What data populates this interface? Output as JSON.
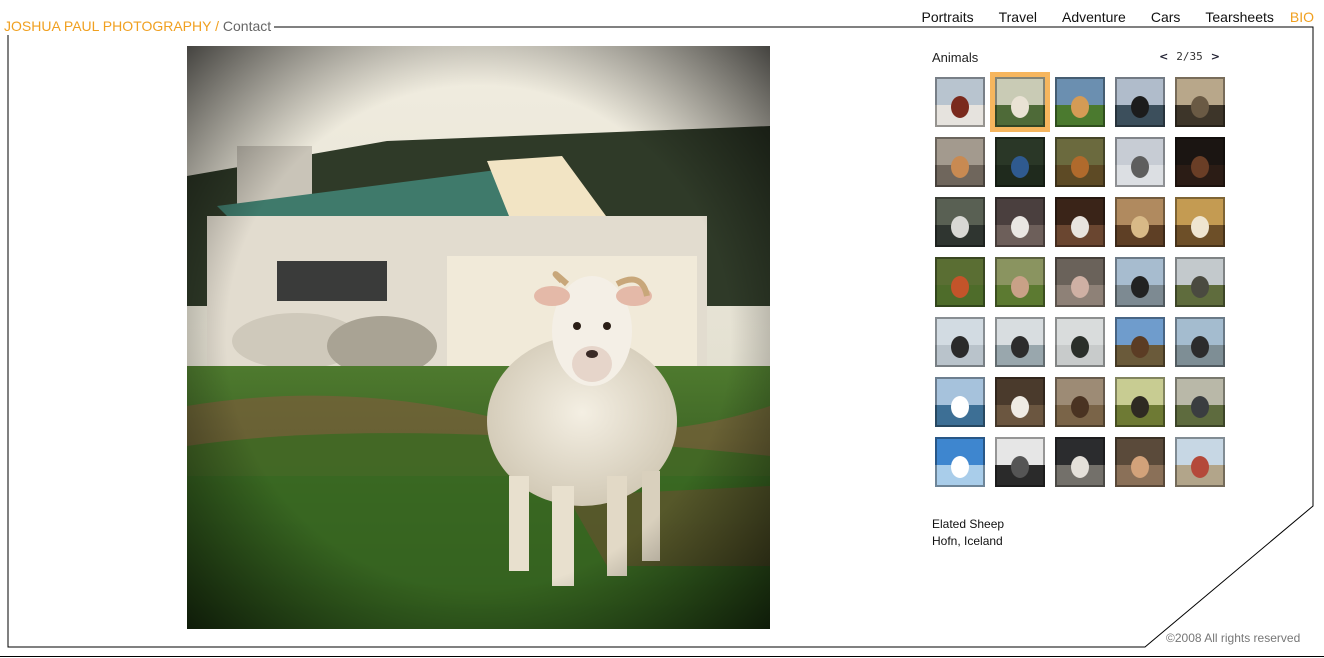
{
  "header": {
    "brand_name": "JOSHUA PAUL PHOTOGRAPHY",
    "brand_separator": " / ",
    "contact_label": "Contact"
  },
  "nav": {
    "items": [
      {
        "label": "Portraits"
      },
      {
        "label": "Travel"
      },
      {
        "label": "Adventure"
      },
      {
        "label": "Cars"
      },
      {
        "label": "Tearsheets"
      }
    ],
    "bio_label": "BIO"
  },
  "gallery": {
    "category": "Animals",
    "prev_icon": "<",
    "next_icon": ">",
    "page_indicator": "2/35",
    "selected_index": 1,
    "thumbnails": [
      {
        "icon": "thumb-child-snow",
        "sky": "#b8c4cf",
        "ground": "#e6e3de",
        "subject": "#7a2a1d"
      },
      {
        "icon": "thumb-sheep",
        "sky": "#c9cbb5",
        "ground": "#4e6a38",
        "subject": "#e9e2d4"
      },
      {
        "icon": "thumb-dog-field",
        "sky": "#6b8fb0",
        "ground": "#4b7a2f",
        "subject": "#d49b55"
      },
      {
        "icon": "thumb-black-dog",
        "sky": "#b0bccb",
        "ground": "#3c4f5c",
        "subject": "#1c1c1c"
      },
      {
        "icon": "thumb-shed",
        "sky": "#b8a78a",
        "ground": "#3d3529",
        "subject": "#6a5a44"
      },
      {
        "icon": "thumb-cat-floor",
        "sky": "#a39a8e",
        "ground": "#6f665c",
        "subject": "#c88a52"
      },
      {
        "icon": "thumb-peacock",
        "sky": "#2a3727",
        "ground": "#1f2a1d",
        "subject": "#2f5a8f"
      },
      {
        "icon": "thumb-fox",
        "sky": "#6b6a3e",
        "ground": "#5d4a25",
        "subject": "#b06a2c"
      },
      {
        "icon": "thumb-husky",
        "sky": "#c7ccd4",
        "ground": "#dcdfe3",
        "subject": "#5e5e5e"
      },
      {
        "icon": "thumb-brown-dog",
        "sky": "#1b1512",
        "ground": "#2b1c15",
        "subject": "#6a3e26"
      },
      {
        "icon": "thumb-monkeys",
        "sky": "#596053",
        "ground": "#2f3530",
        "subject": "#d8d8d4"
      },
      {
        "icon": "thumb-dog-sitting",
        "sky": "#4a3f3e",
        "ground": "#6d5f5a",
        "subject": "#e9e6e2"
      },
      {
        "icon": "thumb-cat-room",
        "sky": "#3a2418",
        "ground": "#6a4630",
        "subject": "#e8e4de"
      },
      {
        "icon": "thumb-room-dog",
        "sky": "#b08a5f",
        "ground": "#5e3f25",
        "subject": "#d8b987"
      },
      {
        "icon": "thumb-doorway",
        "sky": "#c49b52",
        "ground": "#6d4f28",
        "subject": "#efe5d0"
      },
      {
        "icon": "thumb-cows",
        "sky": "#5a6e33",
        "ground": "#4e6c2a",
        "subject": "#c3542a"
      },
      {
        "icon": "thumb-pig-field",
        "sky": "#8a9460",
        "ground": "#5c7a31",
        "subject": "#c9a187"
      },
      {
        "icon": "thumb-pigs",
        "sky": "#6a625a",
        "ground": "#8e8177",
        "subject": "#cfb0a4"
      },
      {
        "icon": "thumb-penguin",
        "sky": "#a7bccf",
        "ground": "#7d8a92",
        "subject": "#222222"
      },
      {
        "icon": "thumb-ram",
        "sky": "#c3c9cc",
        "ground": "#5f6c3d",
        "subject": "#4a4a40"
      },
      {
        "icon": "thumb-penguins-shore",
        "sky": "#d2dbe2",
        "ground": "#b9c3cb",
        "subject": "#2a2a2a"
      },
      {
        "icon": "thumb-penguins-sea",
        "sky": "#d8dde0",
        "ground": "#99a7ad",
        "subject": "#2c2c2c"
      },
      {
        "icon": "thumb-iguana",
        "sky": "#d9dcdc",
        "ground": "#c8cbcb",
        "subject": "#2a2f2a"
      },
      {
        "icon": "thumb-hawk",
        "sky": "#6f9ccc",
        "ground": "#6a5a3a",
        "subject": "#5b3c24"
      },
      {
        "icon": "thumb-seals",
        "sky": "#a4bccf",
        "ground": "#7e8e95",
        "subject": "#2c2c2c"
      },
      {
        "icon": "thumb-bird-sea",
        "sky": "#a6c2dc",
        "ground": "#3d6f95",
        "subject": "#ffffff"
      },
      {
        "icon": "thumb-goat",
        "sky": "#4a3a2c",
        "ground": "#6b5640",
        "subject": "#efebe4"
      },
      {
        "icon": "thumb-horse",
        "sky": "#9d8b75",
        "ground": "#7a6448",
        "subject": "#4a3322"
      },
      {
        "icon": "thumb-dog-tree",
        "sky": "#c8cc92",
        "ground": "#6e7a34",
        "subject": "#2e2a22"
      },
      {
        "icon": "thumb-dome",
        "sky": "#b9b8a8",
        "ground": "#5e6b3e",
        "subject": "#3a3d40"
      },
      {
        "icon": "thumb-sky-cloud",
        "sky": "#3e86cf",
        "ground": "#a9cdea",
        "subject": "#ffffff"
      },
      {
        "icon": "thumb-window",
        "sky": "#e6e6e6",
        "ground": "#2a2a2a",
        "subject": "#555555"
      },
      {
        "icon": "thumb-cat-doorway",
        "sky": "#2b2c2e",
        "ground": "#73706a",
        "subject": "#e4e0d9"
      },
      {
        "icon": "thumb-hand-bird",
        "sky": "#5a4a3a",
        "ground": "#8a7058",
        "subject": "#d2a27a"
      },
      {
        "icon": "thumb-street",
        "sky": "#c7d7e4",
        "ground": "#b2a58a",
        "subject": "#b4493a"
      }
    ]
  },
  "photo": {
    "title": "Elated Sheep",
    "location": "Hofn, Iceland"
  },
  "footer": {
    "copyright": "©2008 All rights reserved"
  },
  "colors": {
    "accent": "#f0a020",
    "frame": "#000000",
    "selected_thumb_border": "#f6b65e"
  }
}
